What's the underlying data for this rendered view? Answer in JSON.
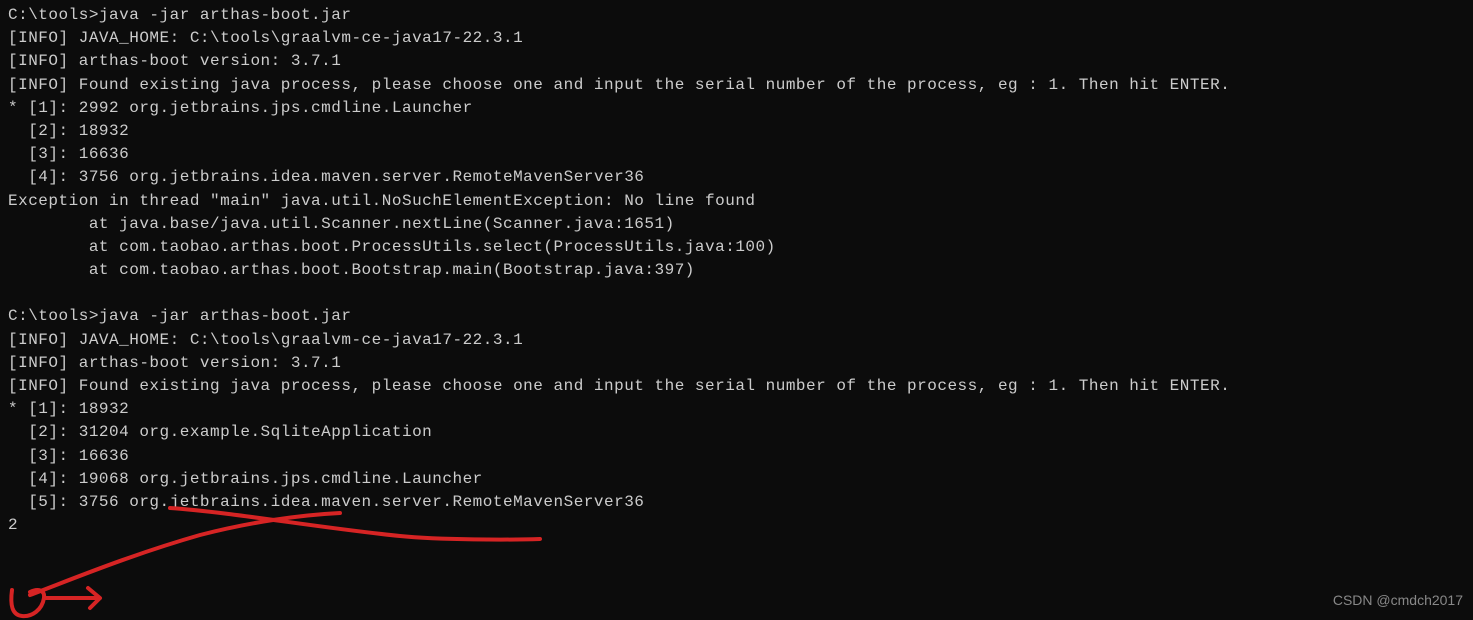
{
  "session1": {
    "prompt": "C:\\tools>java -jar arthas-boot.jar",
    "info_java_home": "[INFO] JAVA_HOME: C:\\tools\\graalvm-ce-java17-22.3.1",
    "info_version": "[INFO] arthas-boot version: 3.7.1",
    "info_found": "[INFO] Found existing java process, please choose one and input the serial number of the process, eg : 1. Then hit ENTER.",
    "proc1": "* [1]: 2992 org.jetbrains.jps.cmdline.Launcher",
    "proc2": "  [2]: 18932 ",
    "proc3": "  [3]: 16636 ",
    "proc4": "  [4]: 3756 org.jetbrains.idea.maven.server.RemoteMavenServer36",
    "exception_head": "Exception in thread \"main\" java.util.NoSuchElementException: No line found",
    "exception_at1": "        at java.base/java.util.Scanner.nextLine(Scanner.java:1651)",
    "exception_at2": "        at com.taobao.arthas.boot.ProcessUtils.select(ProcessUtils.java:100)",
    "exception_at3": "        at com.taobao.arthas.boot.Bootstrap.main(Bootstrap.java:397)"
  },
  "blank": " ",
  "session2": {
    "prompt": "C:\\tools>java -jar arthas-boot.jar",
    "info_java_home": "[INFO] JAVA_HOME: C:\\tools\\graalvm-ce-java17-22.3.1",
    "info_version": "[INFO] arthas-boot version: 3.7.1",
    "info_found": "[INFO] Found existing java process, please choose one and input the serial number of the process, eg : 1. Then hit ENTER.",
    "proc1": "* [1]: 18932 ",
    "proc2": "  [2]: 31204 org.example.SqliteApplication",
    "proc3": "  [3]: 16636 ",
    "proc4": "  [4]: 19068 org.jetbrains.jps.cmdline.Launcher",
    "proc5": "  [5]: 3756 org.jetbrains.idea.maven.server.RemoteMavenServer36",
    "input": "2"
  },
  "watermark": "CSDN @cmdch2017"
}
